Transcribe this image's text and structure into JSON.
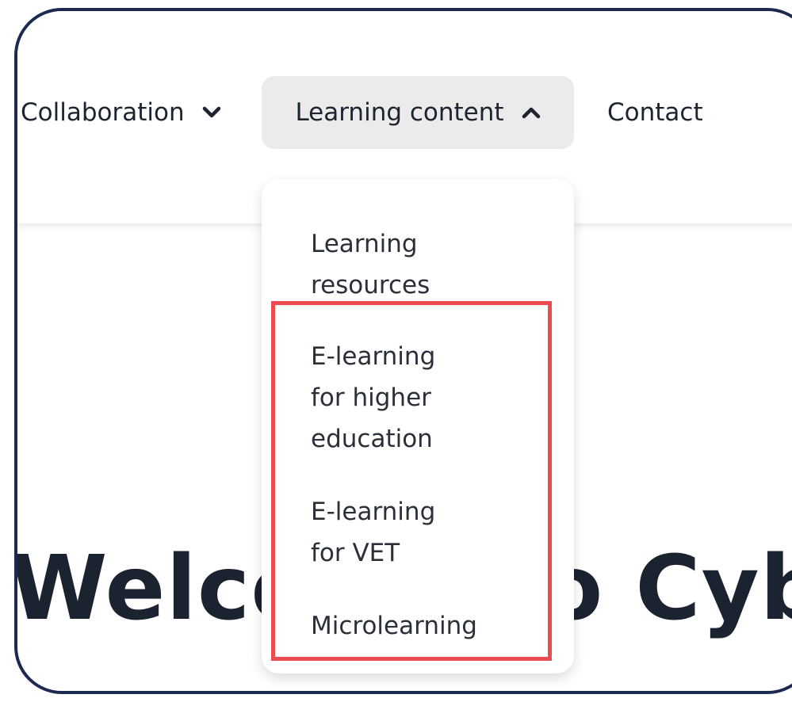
{
  "nav": {
    "items": [
      {
        "label": "Collaboration",
        "chevron": "chevron-down-icon"
      },
      {
        "label": "Learning content",
        "chevron": "chevron-up-icon",
        "active": true
      },
      {
        "label": "Contact"
      }
    ]
  },
  "dropdown": {
    "items": [
      {
        "label": "Learning resources"
      },
      {
        "label": "E-learning for higher education",
        "highlighted": true
      },
      {
        "label": "E-learning for VET",
        "highlighted": true
      },
      {
        "label": "Microlearning",
        "highlighted": true
      }
    ]
  },
  "hero": {
    "title": "Welcome to CyberA"
  },
  "colors": {
    "frame_border": "#1c2951",
    "active_tab_bg": "#ebebec",
    "highlight_border": "#ec4b50",
    "text": "#1d2430"
  }
}
